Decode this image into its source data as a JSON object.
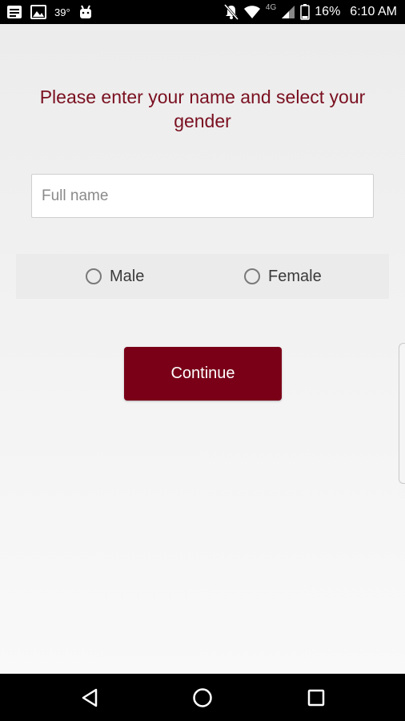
{
  "status_bar": {
    "temperature": "39°",
    "network": "4G",
    "battery": "16%",
    "time": "6:10 AM",
    "icons": [
      "notification-icon",
      "image-icon",
      "android-icon",
      "mute-icon",
      "wifi-icon",
      "signal-icon",
      "battery-icon"
    ]
  },
  "form": {
    "title": "Please enter your name and select your gender",
    "name_placeholder": "Full name",
    "name_value": "",
    "gender_options": [
      "Male",
      "Female"
    ],
    "continue_label": "Continue"
  },
  "colors": {
    "accent": "#7a0018",
    "title": "#7a1020"
  },
  "nav_bar": {
    "icons": [
      "back-icon",
      "home-icon",
      "recents-icon"
    ]
  }
}
